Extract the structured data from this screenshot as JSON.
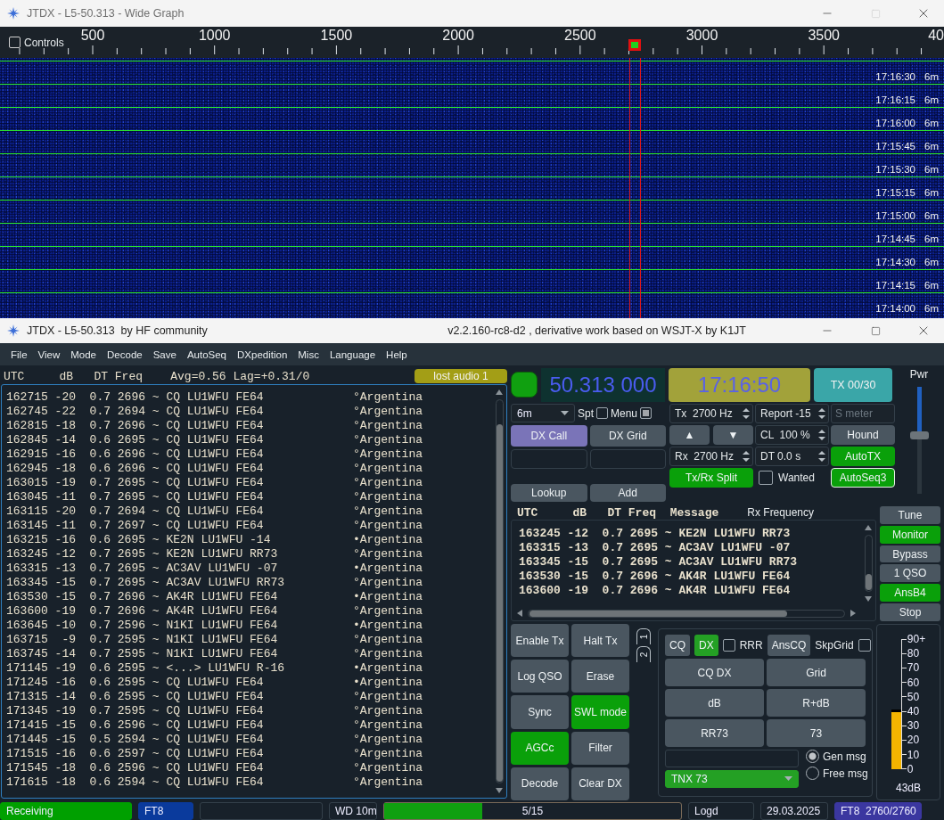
{
  "wide_graph": {
    "title": "JTDX - L5-50.313 - Wide Graph",
    "controls": {
      "label": "Controls",
      "checked": false
    },
    "scale_labels": [
      "500",
      "1000",
      "1500",
      "2000",
      "2500",
      "3000",
      "3500",
      "40"
    ],
    "rows": [
      {
        "time": "17:16:30",
        "band": "6m"
      },
      {
        "time": "17:16:15",
        "band": "6m"
      },
      {
        "time": "17:16:00",
        "band": "6m"
      },
      {
        "time": "17:15:45",
        "band": "6m"
      },
      {
        "time": "17:15:30",
        "band": "6m"
      },
      {
        "time": "17:15:15",
        "band": "6m"
      },
      {
        "time": "17:15:00",
        "band": "6m"
      },
      {
        "time": "17:14:45",
        "band": "6m"
      },
      {
        "time": "17:14:30",
        "band": "6m"
      },
      {
        "time": "17:14:15",
        "band": "6m"
      },
      {
        "time": "17:14:00",
        "band": "6m"
      }
    ]
  },
  "main_window": {
    "title": "JTDX - L5-50.313  by HF community",
    "version": "v2.2.160-rc8-d2 , derivative work based on WSJT-X by K1JT"
  },
  "menu": [
    "File",
    "View",
    "Mode",
    "Decode",
    "Save",
    "AutoSeq",
    "DXpedition",
    "Misc",
    "Language",
    "Help"
  ],
  "band_activity": {
    "header": "UTC     dB   DT Freq    Avg=0.56 Lag=+0.31/0",
    "audio_status": "lost audio 1",
    "rows": [
      {
        "text": "162715 -20  0.7 2696 ~ CQ LU1WFU FE64",
        "country": "°Argentina"
      },
      {
        "text": "162745 -22  0.7 2694 ~ CQ LU1WFU FE64",
        "country": "°Argentina"
      },
      {
        "text": "162815 -18  0.7 2696 ~ CQ LU1WFU FE64",
        "country": "°Argentina"
      },
      {
        "text": "162845 -14  0.6 2695 ~ CQ LU1WFU FE64",
        "country": "°Argentina"
      },
      {
        "text": "162915 -16  0.6 2696 ~ CQ LU1WFU FE64",
        "country": "°Argentina"
      },
      {
        "text": "162945 -18  0.6 2696 ~ CQ LU1WFU FE64",
        "country": "°Argentina"
      },
      {
        "text": "163015 -19  0.7 2695 ~ CQ LU1WFU FE64",
        "country": "°Argentina"
      },
      {
        "text": "163045 -11  0.7 2695 ~ CQ LU1WFU FE64",
        "country": "°Argentina"
      },
      {
        "text": "163115 -20  0.7 2694 ~ CQ LU1WFU FE64",
        "country": "°Argentina"
      },
      {
        "text": "163145 -11  0.7 2697 ~ CQ LU1WFU FE64",
        "country": "°Argentina"
      },
      {
        "text": "163215 -16  0.6 2695 ~ KE2N LU1WFU -14",
        "country": "•Argentina"
      },
      {
        "text": "163245 -12  0.7 2695 ~ KE2N LU1WFU RR73",
        "country": "°Argentina"
      },
      {
        "text": "163315 -13  0.7 2695 ~ AC3AV LU1WFU -07",
        "country": "•Argentina"
      },
      {
        "text": "163345 -15  0.7 2695 ~ AC3AV LU1WFU RR73",
        "country": "°Argentina"
      },
      {
        "text": "163530 -15  0.7 2696 ~ AK4R LU1WFU FE64",
        "country": "•Argentina"
      },
      {
        "text": "163600 -19  0.7 2696 ~ AK4R LU1WFU FE64",
        "country": "°Argentina"
      },
      {
        "text": "163645 -10  0.7 2596 ~ N1KI LU1WFU FE64",
        "country": "•Argentina"
      },
      {
        "text": "163715  -9  0.7 2595 ~ N1KI LU1WFU FE64",
        "country": "°Argentina"
      },
      {
        "text": "163745 -14  0.7 2595 ~ N1KI LU1WFU FE64",
        "country": "°Argentina"
      },
      {
        "text": "171145 -19  0.6 2595 ~ <...> LU1WFU R-16",
        "country": "•Argentina"
      },
      {
        "text": "171245 -16  0.6 2595 ~ CQ LU1WFU FE64",
        "country": "•Argentina"
      },
      {
        "text": "171315 -14  0.6 2595 ~ CQ LU1WFU FE64",
        "country": "°Argentina"
      },
      {
        "text": "171345 -19  0.7 2595 ~ CQ LU1WFU FE64",
        "country": "°Argentina"
      },
      {
        "text": "171415 -15  0.6 2596 ~ CQ LU1WFU FE64",
        "country": "°Argentina"
      },
      {
        "text": "171445 -15  0.5 2594 ~ CQ LU1WFU FE64",
        "country": "°Argentina"
      },
      {
        "text": "171515 -16  0.6 2597 ~ CQ LU1WFU FE64",
        "country": "°Argentina"
      },
      {
        "text": "171545 -18  0.6 2596 ~ CQ LU1WFU FE64",
        "country": "°Argentina"
      },
      {
        "text": "171615 -18  0.6 2594 ~ CQ LU1WFU FE64",
        "country": "°Argentina"
      }
    ]
  },
  "frequency": "50.313 000",
  "clock": "17:16:50",
  "tx_counter": "TX 00/30",
  "band_select": "6m",
  "toggles": [
    {
      "label": "Spt",
      "checked": false
    },
    {
      "label": "Menu",
      "checked": true
    }
  ],
  "dx_buttons": [
    {
      "label": "DX Call",
      "highlighted": true
    },
    {
      "label": "DX Grid",
      "highlighted": false
    }
  ],
  "lookup_buttons": [
    "Lookup",
    "Add"
  ],
  "tx_settings": [
    {
      "kind": "spin",
      "text": "Tx  2700 Hz"
    },
    {
      "kind": "spin",
      "text": "Report -15"
    },
    {
      "kind": "field",
      "placeholder": "S meter"
    },
    {
      "kind": "arrows",
      "up": "▲",
      "down": "▼"
    },
    {
      "kind": "spin",
      "text": "CL  100 %"
    },
    {
      "kind": "button",
      "label": "Hound",
      "on": false
    },
    {
      "kind": "spin",
      "text": "Rx  2700 Hz"
    },
    {
      "kind": "spin",
      "text": "DT 0.0 s"
    },
    {
      "kind": "button",
      "label": "AutoTX",
      "on": true
    },
    {
      "kind": "button",
      "label": "Tx/Rx Split",
      "on": true
    },
    {
      "kind": "checkbox",
      "label": "Wanted",
      "checked": false
    },
    {
      "kind": "button",
      "label": "AutoSeq3",
      "on": true
    }
  ],
  "power": {
    "label": "Pwr",
    "level": 0.55
  },
  "rx_frequency": {
    "header": "UTC     dB   DT Freq  Message",
    "title": "Rx Frequency",
    "rows": [
      "163245 -12  0.7 2695 ~ KE2N LU1WFU RR73",
      "163315 -13  0.7 2695 ~ AC3AV LU1WFU -07",
      "163345 -15  0.7 2695 ~ AC3AV LU1WFU RR73",
      "163530 -15  0.7 2696 ~ AK4R LU1WFU FE64",
      "163600 -19  0.7 2696 ~ AK4R LU1WFU FE64"
    ]
  },
  "side_buttons": [
    {
      "label": "Tune",
      "on": false
    },
    {
      "label": "Monitor",
      "on": true
    },
    {
      "label": "Bypass",
      "on": false
    },
    {
      "label": "1 QSO",
      "on": false
    },
    {
      "label": "AnsB4",
      "on": true
    },
    {
      "label": "Stop",
      "on": false
    }
  ],
  "actions": [
    {
      "label": "Enable Tx",
      "on": false
    },
    {
      "label": "Halt Tx",
      "on": false
    },
    {
      "label": "Log QSO",
      "on": false
    },
    {
      "label": "Erase",
      "on": false
    },
    {
      "label": "Sync",
      "on": false
    },
    {
      "label": "SWL mode",
      "on": true
    },
    {
      "label": "AGCc",
      "on": true
    },
    {
      "label": "Filter",
      "on": false
    },
    {
      "label": "Decode",
      "on": false
    },
    {
      "label": "Clear DX",
      "on": false
    }
  ],
  "message_tabs": [
    "1",
    "2"
  ],
  "message_panel": {
    "options": [
      {
        "kind": "button",
        "label": "CQ",
        "on": false
      },
      {
        "kind": "button",
        "label": "DX",
        "on": true
      },
      {
        "kind": "checkbox",
        "label": "RRR",
        "checked": false
      },
      {
        "kind": "button",
        "label": "AnsCQ",
        "on": false
      },
      {
        "kind": "labeledcheckbox",
        "label": "SkpGrid",
        "checked": false
      }
    ],
    "messages": [
      "CQ DX",
      "Grid",
      "dB",
      "R+dB",
      "RR73",
      "73"
    ],
    "free_message": "TNX 73",
    "modes": [
      {
        "label": "Gen msg",
        "selected": true
      },
      {
        "label": "Free msg",
        "selected": false
      }
    ]
  },
  "signal_meter": {
    "scale": [
      "90+",
      "80",
      "70",
      "60",
      "50",
      "40",
      "30",
      "20",
      "10",
      "0"
    ],
    "level": 0.46,
    "reading": "43dB"
  },
  "status_bar": [
    {
      "kind": "label",
      "text": "Receiving",
      "color": "#00a000"
    },
    {
      "kind": "label",
      "text": "FT8",
      "color": "#0a3a9c"
    },
    {
      "kind": "blank"
    },
    {
      "kind": "label",
      "text": "WD 10m"
    },
    {
      "kind": "progress",
      "text": "5/15",
      "level": 0.33
    },
    {
      "kind": "label",
      "text": "Logd"
    },
    {
      "kind": "label",
      "text": "29.03.2025"
    },
    {
      "kind": "label",
      "text": "FT8  2760/2760",
      "color": "#3b37a0"
    }
  ]
}
